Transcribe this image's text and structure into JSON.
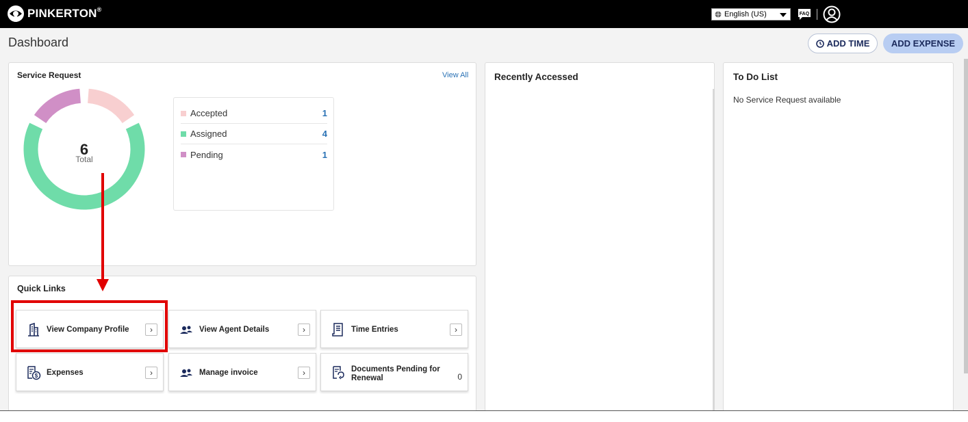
{
  "header": {
    "brand": "PINKERTON",
    "brand_mark": "®",
    "language": "English (US)",
    "faq_icon": "faq-icon",
    "user_icon": "user-icon"
  },
  "page": {
    "title": "Dashboard",
    "add_time_label": "ADD TIME",
    "add_expense_label": "ADD EXPENSE"
  },
  "service_request": {
    "title": "Service Request",
    "view_all": "View All",
    "total": "6",
    "total_label": "Total",
    "legend": [
      {
        "label": "Accepted",
        "count": "1",
        "color": "#f8cfd0",
        "value": 1
      },
      {
        "label": "Assigned",
        "count": "4",
        "color": "#6fdca9",
        "value": 4
      },
      {
        "label": "Pending",
        "count": "1",
        "color": "#d08fc6",
        "value": 1
      }
    ]
  },
  "quick_links": {
    "title": "Quick Links",
    "items": [
      {
        "label": "View Company Profile",
        "icon": "building-icon"
      },
      {
        "label": "View Agent Details",
        "icon": "people-icon"
      },
      {
        "label": "Time Entries",
        "icon": "document-list-icon"
      },
      {
        "label": "Expenses",
        "icon": "expense-dollar-icon"
      },
      {
        "label": "Manage invoice",
        "icon": "people-icon"
      },
      {
        "label": "Documents Pending for Renewal",
        "icon": "document-renew-icon",
        "count": "0"
      }
    ]
  },
  "recently_accessed": {
    "title": "Recently Accessed"
  },
  "todo": {
    "title": "To Do List",
    "empty_message": "No Service Request available"
  },
  "colors": {
    "accent_red": "#e10000",
    "link_blue": "#2a72b5",
    "navy": "#1b2a5c"
  }
}
